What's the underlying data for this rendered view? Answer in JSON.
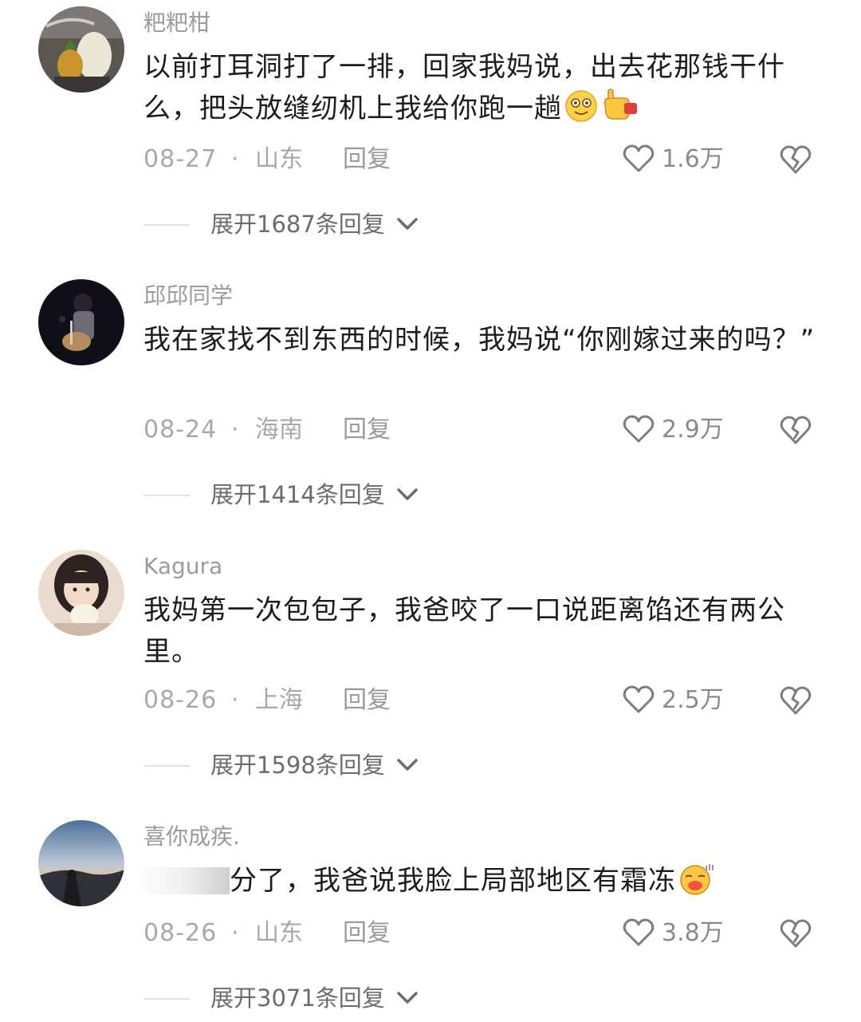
{
  "comments": [
    {
      "username": "粑粑柑",
      "text": "以前打耳洞打了一排，回家我妈说，出去花那钱干什么，把头放缝纫机上我给你跑一趟",
      "date": "08-27",
      "dot": "·",
      "location": "山东",
      "reply_label": "回复",
      "likes": "1.6万",
      "expand_label": "展开1687条回复"
    },
    {
      "username": "邱邱同学",
      "text": "我在家找不到东西的时候，我妈说“你刚嫁过来的吗？”",
      "date": "08-24",
      "dot": "·",
      "location": "海南",
      "reply_label": "回复",
      "likes": "2.9万",
      "expand_label": "展开1414条回复"
    },
    {
      "username": "Kagura",
      "text": "我妈第一次包包子，我爸咬了一口说距离馅还有两公里。",
      "date": "08-26",
      "dot": "·",
      "location": "上海",
      "reply_label": "回复",
      "likes": "2.5万",
      "expand_label": "展开1598条回复"
    },
    {
      "username": "喜你成疾.",
      "text": "分了，我爸说我脸上局部地区有霜冻",
      "date": "08-26",
      "dot": "·",
      "location": "山东",
      "reply_label": "回复",
      "likes": "3.8万",
      "expand_label": "展开3071条回复"
    }
  ],
  "icons": {
    "like": "heart-outline-icon",
    "dislike": "broken-heart-icon",
    "expand": "chevron-down-icon",
    "emoji_1a": "smiling-face-emoji",
    "emoji_1b": "pointing-hand-emoji",
    "emoji_4": "kissing-face-emoji"
  },
  "colors": {
    "username": "#9b9b9b",
    "text": "#1c1c1c",
    "meta": "#a8a8a8",
    "expand": "#6c6c6c"
  }
}
